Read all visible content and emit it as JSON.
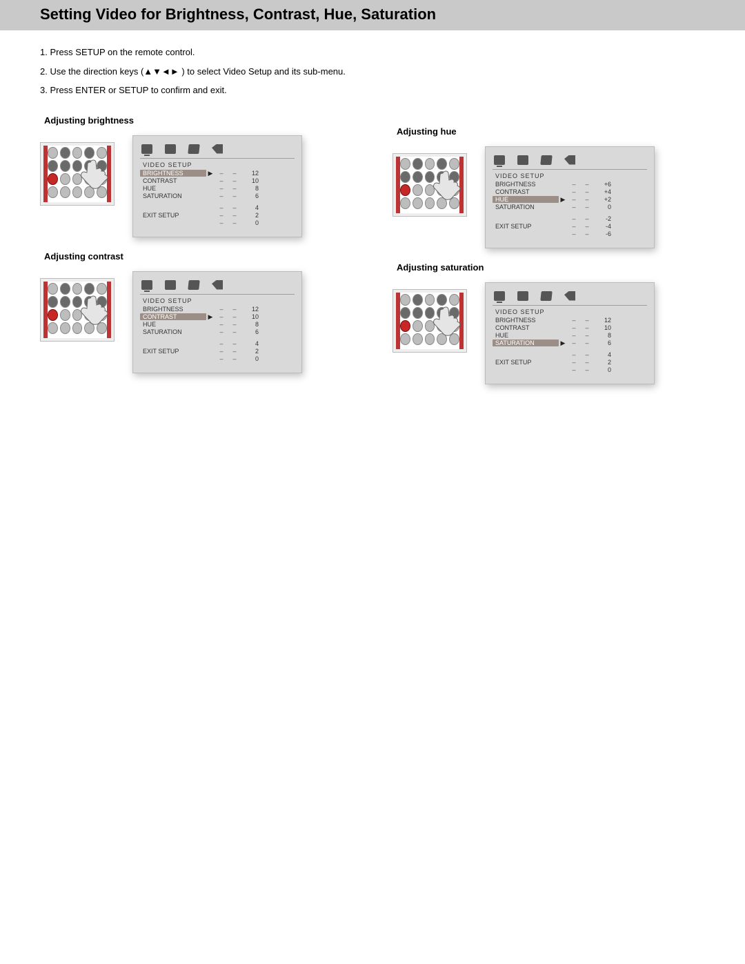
{
  "header": {
    "title": "Setting Video for Brightness, Contrast, Hue, Saturation"
  },
  "steps": [
    "1. Press SETUP on the remote control.",
    "2. Use the direction keys (▲▼◄► ) to select Video Setup and its sub-menu.",
    "3. Press ENTER or SETUP to confirm and exit."
  ],
  "figures": {
    "brightness": {
      "heading": "Adjusting brightness",
      "menu_title": "VIDEO SETUP",
      "rows": [
        {
          "label": "BRIGHTNESS",
          "selected": true,
          "value": "12"
        },
        {
          "label": "CONTRAST",
          "selected": false,
          "value": "10"
        },
        {
          "label": "HUE",
          "selected": false,
          "value": "8"
        },
        {
          "label": "SATURATION",
          "selected": false,
          "value": "6"
        },
        {
          "label": "",
          "selected": false,
          "value": "4"
        },
        {
          "label": "EXIT SETUP",
          "selected": false,
          "value": "2"
        },
        {
          "label": "",
          "selected": false,
          "value": "0"
        }
      ]
    },
    "contrast": {
      "heading": "Adjusting contrast",
      "menu_title": "VIDEO SETUP",
      "rows": [
        {
          "label": "BRIGHTNESS",
          "selected": false,
          "value": "12"
        },
        {
          "label": "CONTRAST",
          "selected": true,
          "value": "10"
        },
        {
          "label": "HUE",
          "selected": false,
          "value": "8"
        },
        {
          "label": "SATURATION",
          "selected": false,
          "value": "6"
        },
        {
          "label": "",
          "selected": false,
          "value": "4"
        },
        {
          "label": "EXIT SETUP",
          "selected": false,
          "value": "2"
        },
        {
          "label": "",
          "selected": false,
          "value": "0"
        }
      ]
    },
    "hue": {
      "heading": "Adjusting hue",
      "menu_title": "VIDEO SETUP",
      "rows": [
        {
          "label": "BRIGHTNESS",
          "selected": false,
          "value": "+6"
        },
        {
          "label": "CONTRAST",
          "selected": false,
          "value": "+4"
        },
        {
          "label": "HUE",
          "selected": true,
          "value": "+2"
        },
        {
          "label": "SATURATION",
          "selected": false,
          "value": "0"
        },
        {
          "label": "",
          "selected": false,
          "value": "-2"
        },
        {
          "label": "EXIT SETUP",
          "selected": false,
          "value": "-4"
        },
        {
          "label": "",
          "selected": false,
          "value": "-6"
        }
      ]
    },
    "saturation": {
      "heading": "Adjusting saturation",
      "menu_title": "VIDEO SETUP",
      "rows": [
        {
          "label": "BRIGHTNESS",
          "selected": false,
          "value": "12"
        },
        {
          "label": "CONTRAST",
          "selected": false,
          "value": "10"
        },
        {
          "label": "HUE",
          "selected": false,
          "value": "8"
        },
        {
          "label": "SATURATION",
          "selected": true,
          "value": "6"
        },
        {
          "label": "",
          "selected": false,
          "value": "4"
        },
        {
          "label": "EXIT SETUP",
          "selected": false,
          "value": "2"
        },
        {
          "label": "",
          "selected": false,
          "value": "0"
        }
      ]
    }
  }
}
